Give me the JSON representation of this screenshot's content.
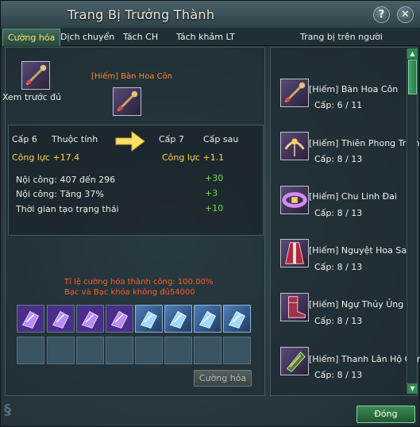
{
  "window": {
    "title": "Trang Bị Trưởng Thành"
  },
  "title_buttons": {
    "help": "?",
    "close": "✕"
  },
  "tabs": [
    {
      "label": "Cường hóa",
      "active": true
    },
    {
      "label": "Dịch chuyển",
      "active": false
    },
    {
      "label": "Tách CH",
      "active": false
    },
    {
      "label": "Tách khảm LT",
      "active": false
    }
  ],
  "right_header": "Trang bị trên người",
  "preview": {
    "label": "Xem trước đủ",
    "item_name": "[Hiếm] Bàn Hoa Côn"
  },
  "stats": {
    "cur_level": "Cấp 6",
    "attr_header": "Thuộc tính",
    "next_level": "Cấp 7",
    "after_header": "Cấp sau",
    "cur_power": "Công lực +17.4",
    "next_power": "Công lực +1.1",
    "rows": [
      {
        "label": "Nội công: 407 đến 296",
        "delta": "+30"
      },
      {
        "label": "Nội công: Tăng 37%",
        "delta": "+3"
      },
      {
        "label": "Thời gian tạo trạng thái",
        "delta": "+10"
      }
    ]
  },
  "messages": {
    "success_rate": "Tỉ lệ cường hóa thành công: 100.00%",
    "silver_warning": "Bạc và Bạc khóa không đủ54000"
  },
  "buttons": {
    "enhance": "Cường hóa",
    "close": "Đóng"
  },
  "equipped": [
    {
      "name": "[Hiếm] Bàn Hoa Côn",
      "level": "Cấp: 6 / 11",
      "icon": "staff-icon"
    },
    {
      "name": "[Hiếm] Thiên Phong Trâm",
      "level": "Cấp: 8 / 13",
      "icon": "hairpin-icon"
    },
    {
      "name": "[Hiếm] Chu Linh Đai",
      "level": "Cấp: 8 / 13",
      "icon": "belt-icon"
    },
    {
      "name": "[Hiếm] Nguyệt Hoa Sam",
      "level": "Cấp: 8 / 13",
      "icon": "robe-icon"
    },
    {
      "name": "[Hiếm] Ngự Thủy Ủng",
      "level": "Cấp: 8 / 13",
      "icon": "boots-icon"
    },
    {
      "name": "[Hiếm] Thanh Lân Hộ Oản",
      "level": "Cấp: 8 / 13",
      "icon": "bracer-icon"
    }
  ],
  "colors": {
    "level_text_orange": "#ff8a2e",
    "power_yellow": "#ffd34a",
    "delta_green": "#7bd84a",
    "warning_red": "#ff5a2a",
    "active_tab": "#ffe56a"
  }
}
